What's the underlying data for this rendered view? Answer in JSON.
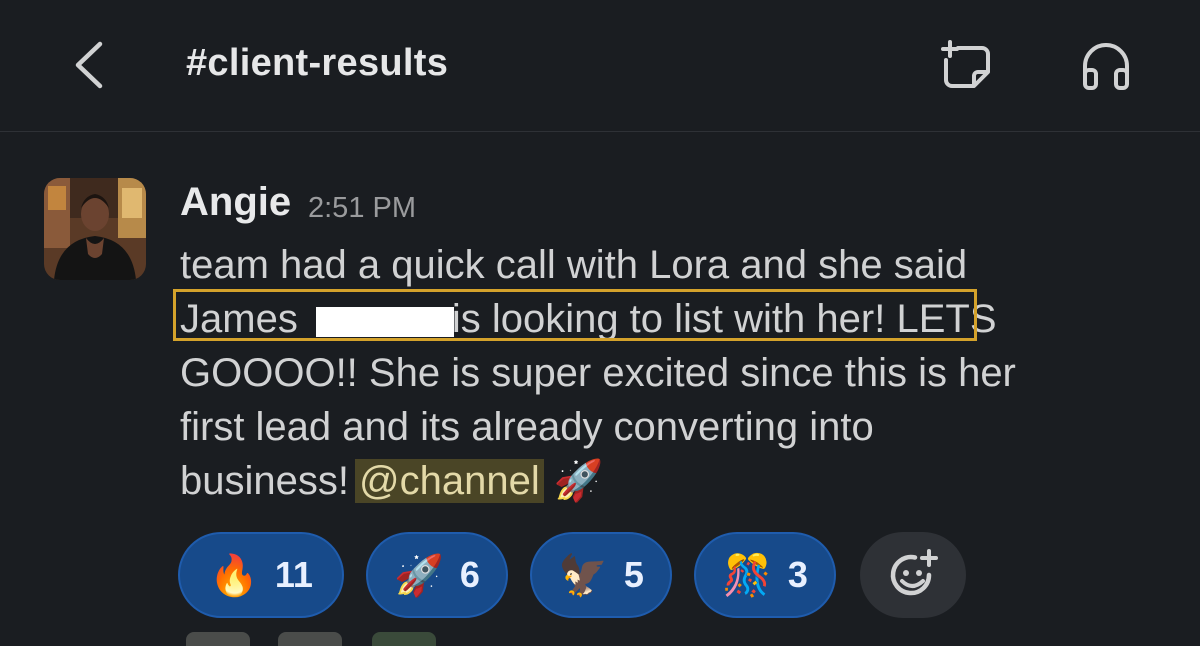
{
  "header": {
    "channel_name": "#client-results",
    "icons": [
      "chevron-left-icon",
      "new-canvas-icon",
      "headphones-icon"
    ]
  },
  "message": {
    "sender": "Angie",
    "timestamp": "2:51 PM",
    "lines": [
      "team had a quick call with Lora and she said",
      "James",
      "is looking to list with her!",
      "LETS",
      "GOOOO!! She is super excited since this is her",
      "first lead and its already converting into",
      "business!"
    ],
    "mention": "@channel",
    "trailing_emoji": "🚀"
  },
  "reactions": [
    {
      "emoji": "🔥",
      "count": "11"
    },
    {
      "emoji": "🚀",
      "count": "6"
    },
    {
      "emoji": "🦅",
      "count": "5"
    },
    {
      "emoji": "🎊",
      "count": "3"
    }
  ],
  "colors": {
    "background": "#1a1d21",
    "reaction_fill": "#174a8a",
    "highlight_border": "#d4a22b",
    "mention_bg": "#4a4526"
  }
}
